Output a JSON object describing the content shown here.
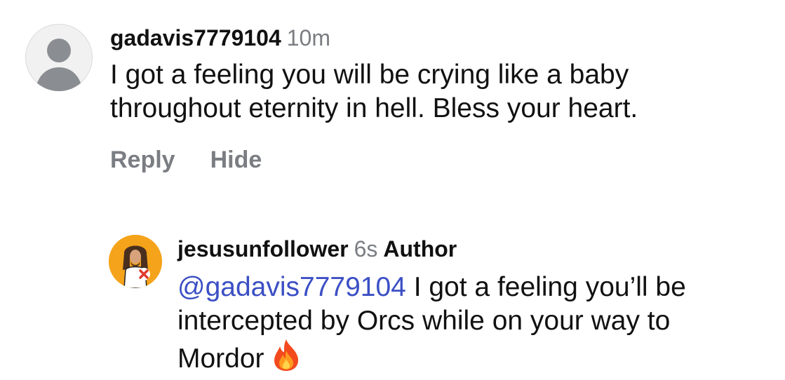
{
  "comment": {
    "username": "gadavis7779104",
    "time": "10m",
    "text_line1": "I got a feeling you will be crying like a baby",
    "text_line2": "throughout eternity in hell.  Bless your heart.",
    "reply_label": "Reply",
    "hide_label": "Hide",
    "avatar_icon": "default-user-icon"
  },
  "reply": {
    "username": "jesusunfollower",
    "time": "6s",
    "badge": "Author",
    "mention": "@gadavis7779104",
    "text_line1_rest": " I got a feeling you’ll be",
    "text_line2": "intercepted by Orcs while on your way to",
    "text_line3": "Mordor",
    "emoji_icon": "fire-emoji-icon",
    "avatar_icon": "jesus-unfollow-avatar-icon",
    "avatar_bg": "#f5a31a"
  },
  "colors": {
    "text": "#111111",
    "muted": "#7a7d82",
    "mention": "#3b4fc4"
  }
}
